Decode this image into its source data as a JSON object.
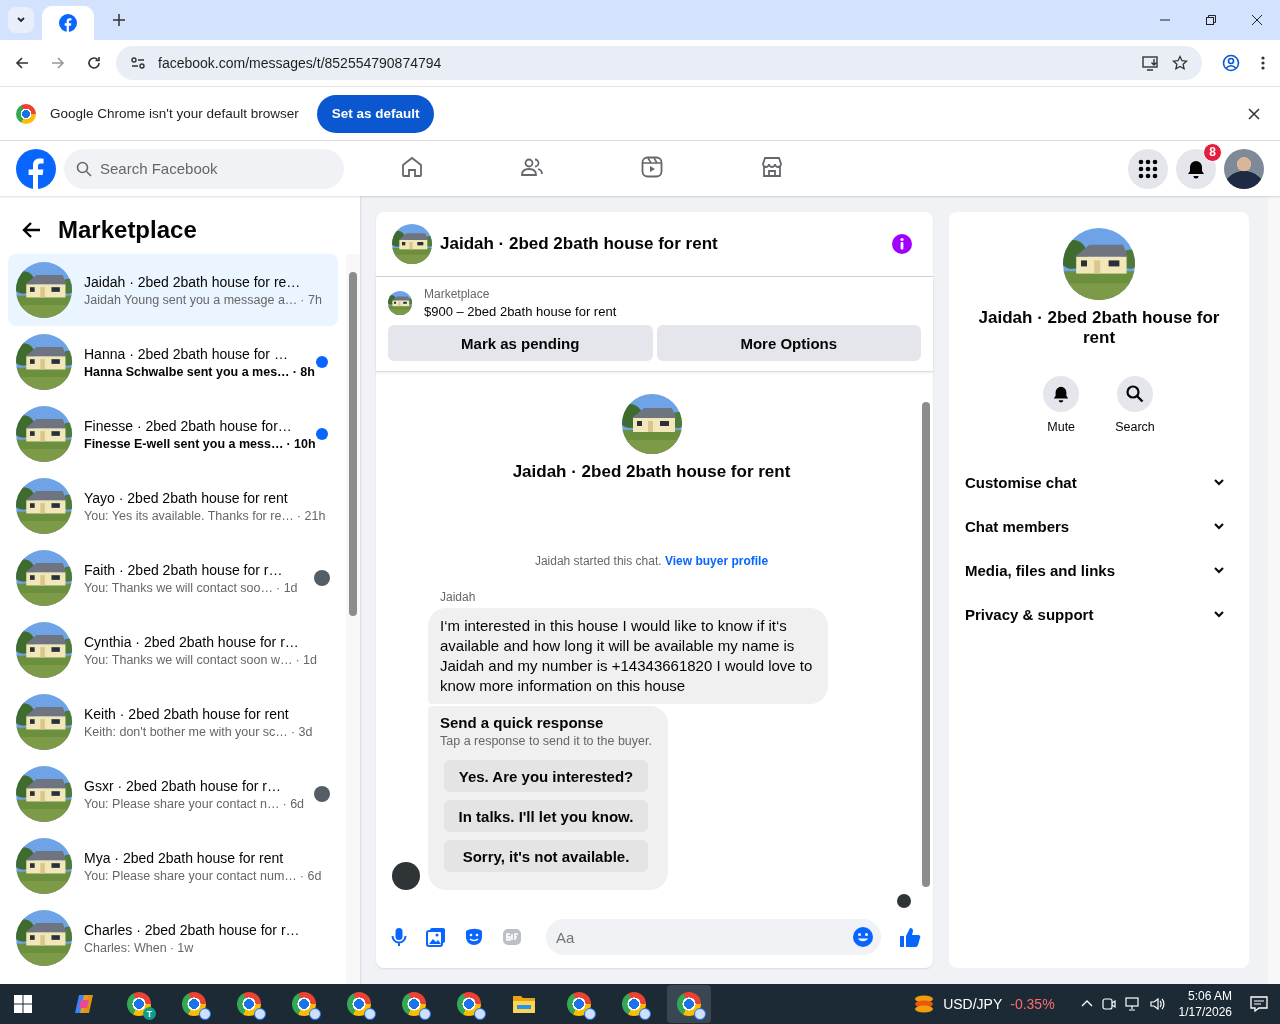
{
  "browser": {
    "url": "facebook.com/messages/t/852554790874794",
    "infobar": {
      "text": "Google Chrome isn't your default browser",
      "button": "Set as default"
    }
  },
  "topnav": {
    "search_placeholder": "Search Facebook",
    "nav": [
      {
        "kind": "home",
        "selected": false
      },
      {
        "kind": "friends",
        "selected": false
      },
      {
        "kind": "video",
        "selected": false
      },
      {
        "kind": "marketplace",
        "selected": false
      }
    ],
    "notification_count": "8"
  },
  "sidebar": {
    "title": "Marketplace",
    "conversations": [
      {
        "title": "Jaidah · 2bed 2bath house for re…",
        "preview": "Jaidah Young sent you a message a…",
        "time": "· 7h",
        "selected": true,
        "unread": false,
        "seen": false
      },
      {
        "title": "Hanna · 2bed 2bath house for …",
        "preview": "Hanna Schwalbe sent you a mes…",
        "time": "· 8h",
        "selected": false,
        "unread": true,
        "seen": false
      },
      {
        "title": "Finesse · 2bed 2bath house for…",
        "preview": "Finesse E-well sent you a mess…",
        "time": "· 10h",
        "selected": false,
        "unread": true,
        "seen": false
      },
      {
        "title": "Yayo · 2bed 2bath house for rent",
        "preview": "You: Yes its available. Thanks for re…",
        "time": "· 21h",
        "selected": false,
        "unread": false,
        "seen": false
      },
      {
        "title": "Faith · 2bed 2bath house for r…",
        "preview": "You: Thanks we will contact soo…",
        "time": "· 1d",
        "selected": false,
        "unread": false,
        "seen": true
      },
      {
        "title": "Cynthia · 2bed 2bath house for r…",
        "preview": "You: Thanks we will contact soon w…",
        "time": "· 1d",
        "selected": false,
        "unread": false,
        "seen": false
      },
      {
        "title": "Keith · 2bed 2bath house for rent",
        "preview": "Keith: don't bother me with your sc…",
        "time": "· 3d",
        "selected": false,
        "unread": false,
        "seen": false
      },
      {
        "title": "Gsxr · 2bed 2bath house for r…",
        "preview": "You: Please share your contact n…",
        "time": "· 6d",
        "selected": false,
        "unread": false,
        "seen": true
      },
      {
        "title": "Mya · 2bed 2bath house for rent",
        "preview": "You: Please share your contact num…",
        "time": "· 6d",
        "selected": false,
        "unread": false,
        "seen": false
      },
      {
        "title": "Charles · 2bed 2bath house for r…",
        "preview": "Charles: When",
        "time": "· 1w",
        "selected": false,
        "unread": false,
        "seen": false
      }
    ]
  },
  "chat": {
    "title": "Jaidah · 2bed 2bath house for rent",
    "listing": {
      "label": "Marketplace",
      "name": "$900 – 2bed 2bath house for rent"
    },
    "actions": [
      "Mark as pending",
      "More Options"
    ],
    "intro_title": "Jaidah · 2bed 2bath house for rent",
    "started": "Jaidah started this chat.",
    "profile_link": "View buyer profile",
    "sender": "Jaidah",
    "message": "I‘m interested in this house I would like to know if it‘s available and how long it will be available my name is Jaidah and my number is +14343661820 I would love to know more information on this house",
    "quick": {
      "title": "Send a quick response",
      "subtitle": "Tap a response to send it to the buyer.",
      "responses": [
        "Yes. Are you interested?",
        "In talks. I'll let you know.",
        "Sorry, it's not available."
      ]
    },
    "composer_placeholder": "Aa"
  },
  "details": {
    "title": "Jaidah · 2bed 2bath house for rent",
    "actions": [
      {
        "kind": "mute",
        "label": "Mute"
      },
      {
        "kind": "search",
        "label": "Search"
      }
    ],
    "sections": [
      {
        "label": "Customise chat",
        "expanded": false
      },
      {
        "label": "Chat members",
        "expanded": false
      },
      {
        "label": "Media, files and links",
        "expanded": false
      },
      {
        "label": "Privacy & support",
        "expanded": false
      }
    ]
  },
  "taskbar": {
    "apps": [
      {
        "kind": "copilot",
        "selected": false
      },
      {
        "kind": "chrome",
        "badge": "T",
        "selected": false
      },
      {
        "kind": "chrome",
        "selected": false
      },
      {
        "kind": "chrome",
        "selected": false
      },
      {
        "kind": "chrome",
        "selected": false
      },
      {
        "kind": "chrome",
        "selected": false
      },
      {
        "kind": "chrome",
        "selected": false
      },
      {
        "kind": "chrome",
        "selected": false
      },
      {
        "kind": "folder",
        "selected": false
      },
      {
        "kind": "chrome",
        "selected": false
      },
      {
        "kind": "chrome",
        "selected": false
      },
      {
        "kind": "chrome",
        "selected": true
      }
    ],
    "ticker": "USD/JPY",
    "change": "-0.35%",
    "time": "5:06 AM",
    "date": "1/17/2026"
  }
}
